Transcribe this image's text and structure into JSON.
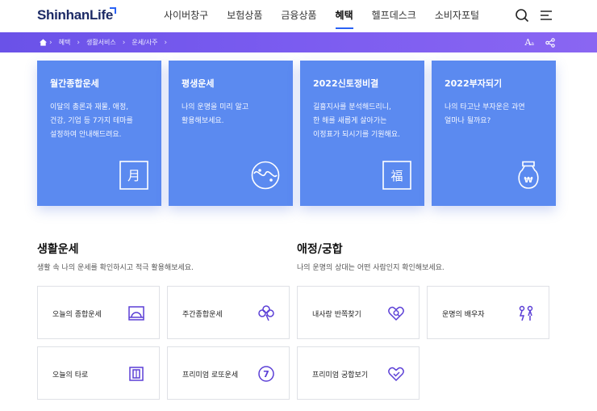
{
  "header": {
    "logo": "ShinhanLife",
    "nav": [
      "사이버창구",
      "보험상품",
      "금융상품",
      "혜택",
      "헬프데스크",
      "소비자포털"
    ],
    "active_index": 3
  },
  "breadcrumb": {
    "items": [
      "혜택",
      "생활서비스",
      "운세/사주"
    ],
    "font_label": "A",
    "font_small": "a"
  },
  "cards": [
    {
      "title": "월간종합운세",
      "desc": "이달의 총론과 재물, 애정,\n건강, 기업 등 7가지 테마를\n설정하여 안내해드려요.",
      "icon": "moon-char-icon",
      "glyph": "月"
    },
    {
      "title": "평생운세",
      "desc": "나의 운명을 미리 알고\n활용해보세요.",
      "icon": "yin-yang-icon"
    },
    {
      "title": "2022신토정비결",
      "desc": "길흉지사를 분석해드리니,\n한 해를 새롭게 살아가는\n이정표가 되시기를 기원해요.",
      "icon": "fortune-char-icon",
      "glyph": "福"
    },
    {
      "title": "2022부자되기",
      "desc": "나의 타고난 부자운은 과연\n얼마나 될까요?",
      "icon": "money-bag-icon",
      "glyph": "₩"
    }
  ],
  "sections": [
    {
      "title": "생활운세",
      "desc": "생활 속 나의 운세를 확인하시고 적극 활용해보세요."
    },
    {
      "title": "애정/궁합",
      "desc": "나의 운명의 상대는 어떤 사람인지 확인해보세요."
    }
  ],
  "tiles": [
    {
      "label": "오늘의 종합운세",
      "icon": "sunrise-window-icon"
    },
    {
      "label": "주간종합운세",
      "icon": "clover-icon"
    },
    {
      "label": "내사랑 반쪽찾기",
      "icon": "heart-search-icon"
    },
    {
      "label": "운명의 배우자",
      "icon": "couple-icon"
    },
    {
      "label": "오늘의 타로",
      "icon": "tarot-cards-icon"
    },
    {
      "label": "프리미엄 로또운세",
      "icon": "lotto-ball-icon",
      "glyph": "7"
    },
    {
      "label": "프리미엄 궁합보기",
      "icon": "heart-check-icon"
    }
  ],
  "colors": {
    "accent": "#5b8af0",
    "purple_bar": "#7458ec",
    "brand_navy": "#1d2b66",
    "icon_purple": "#5b3fd6"
  }
}
